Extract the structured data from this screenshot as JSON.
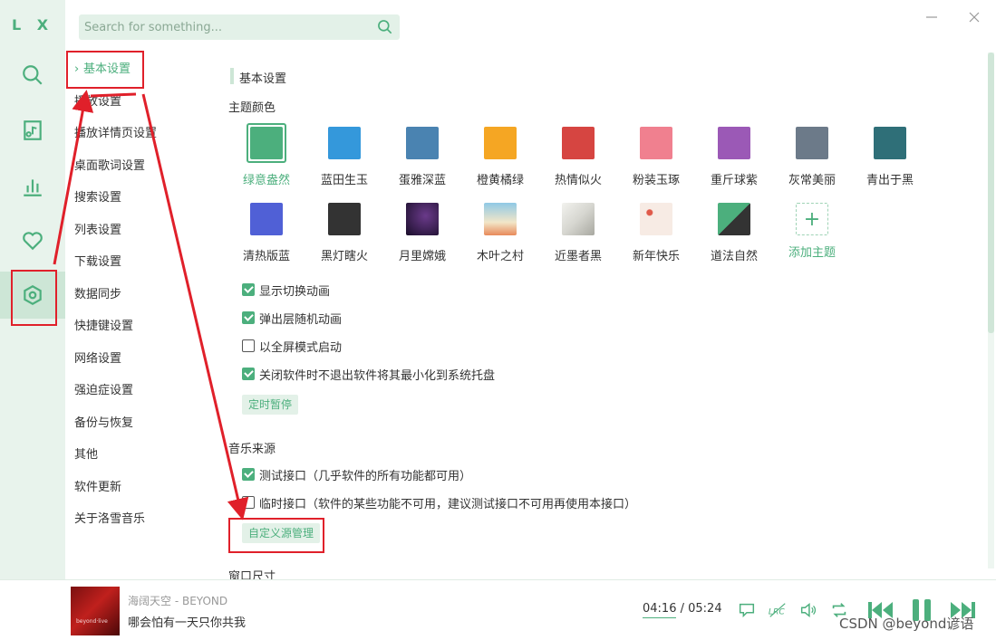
{
  "app": {
    "logo": "L X"
  },
  "rail": {
    "items": [
      {
        "name": "search-icon"
      },
      {
        "name": "music-library-icon"
      },
      {
        "name": "chart-icon"
      },
      {
        "name": "heart-icon"
      },
      {
        "name": "settings-icon"
      }
    ]
  },
  "search": {
    "placeholder": "Search for something..."
  },
  "nav": {
    "items": [
      {
        "label": "基本设置"
      },
      {
        "label": "播放设置"
      },
      {
        "label": "播放详情页设置"
      },
      {
        "label": "桌面歌词设置"
      },
      {
        "label": "搜索设置"
      },
      {
        "label": "列表设置"
      },
      {
        "label": "下载设置"
      },
      {
        "label": "数据同步"
      },
      {
        "label": "快捷键设置"
      },
      {
        "label": "网络设置"
      },
      {
        "label": "强迫症设置"
      },
      {
        "label": "备份与恢复"
      },
      {
        "label": "其他"
      },
      {
        "label": "软件更新"
      },
      {
        "label": "关于洛雪音乐"
      }
    ]
  },
  "content": {
    "section_title": "基本设置",
    "theme_title": "主题颜色",
    "themes": [
      {
        "label": "绿意盎然",
        "color": "#4caf7d"
      },
      {
        "label": "蓝田生玉",
        "color": "#3498db"
      },
      {
        "label": "蛋雅深蓝",
        "color": "#4a83b1"
      },
      {
        "label": "橙黄橘绿",
        "color": "#f5a623"
      },
      {
        "label": "热情似火",
        "color": "#d64541"
      },
      {
        "label": "粉装玉琢",
        "color": "#f0808f"
      },
      {
        "label": "重斤球紫",
        "color": "#9b59b6"
      },
      {
        "label": "灰常美丽",
        "color": "#6c7a89"
      },
      {
        "label": "青出于黑",
        "color": "#2f6f78"
      },
      {
        "label": "清热版蓝",
        "color": "#5060d6"
      },
      {
        "label": "黑灯瞎火",
        "color": "#333333"
      },
      {
        "label": "月里嫦娥",
        "color": "#2a1a3a"
      },
      {
        "label": "木叶之村",
        "color": "#8fc9e6"
      },
      {
        "label": "近墨者黑",
        "color": "#e4e4e0"
      },
      {
        "label": "新年快乐",
        "color": "#f7ebe4"
      },
      {
        "label": "道法自然",
        "color": "#4caf7d"
      }
    ],
    "add_theme": "添加主题",
    "checkboxes": [
      {
        "label": "显示切换动画",
        "checked": true
      },
      {
        "label": "弹出层随机动画",
        "checked": true
      },
      {
        "label": "以全屏模式启动",
        "checked": false
      },
      {
        "label": "关闭软件时不退出软件将其最小化到系统托盘",
        "checked": true
      }
    ],
    "timer_button": "定时暂停",
    "source_title": "音乐来源",
    "sources": [
      {
        "label": "测试接口（几乎软件的所有功能都可用）",
        "checked": true
      },
      {
        "label": "临时接口（软件的某些功能不可用，建议测试接口不可用再使用本接口）",
        "checked": false
      }
    ],
    "custom_source_button": "自定义源管理",
    "window_size_title": "窗口尺寸"
  },
  "player": {
    "title": "海阔天空 - BEYOND",
    "lyric": "哪会怕有一天只你共我",
    "current_time": "04:16",
    "separator": " / ",
    "total_time": "05:24",
    "cover_text": "beyond·live"
  },
  "watermark": "CSDN @beyond谚语",
  "colors": {
    "accent": "#4caf7d",
    "annotation": "#e0202a"
  }
}
